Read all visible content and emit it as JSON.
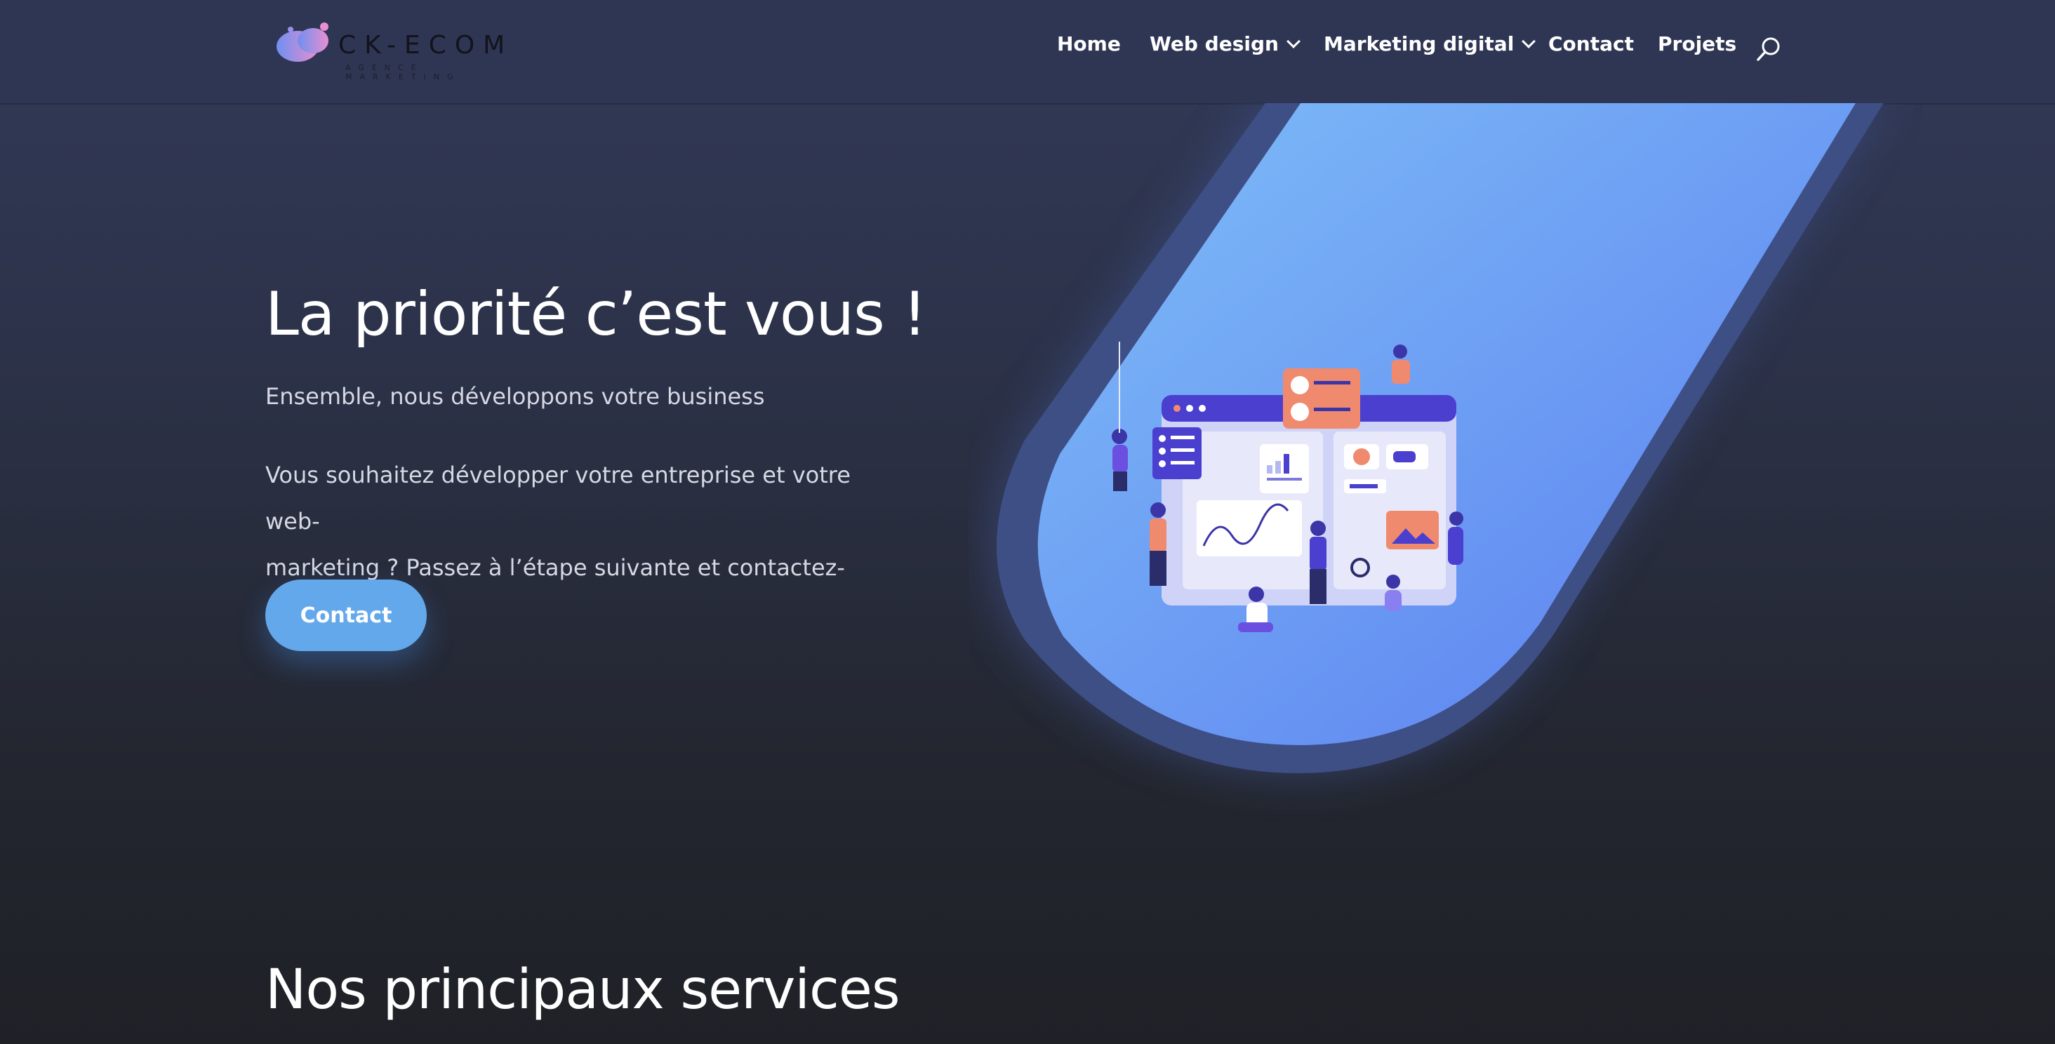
{
  "brand": {
    "name": "CK-ECOM",
    "tagline": "AGENCE MARKETING"
  },
  "nav": {
    "items": [
      {
        "label": "Home",
        "dropdown": false
      },
      {
        "label": "Web design",
        "dropdown": true
      },
      {
        "label": "Marketing digital",
        "dropdown": true
      },
      {
        "label": "Contact",
        "dropdown": false
      },
      {
        "label": "Projets",
        "dropdown": false
      }
    ],
    "search_icon": "search-icon"
  },
  "hero": {
    "title": "La priorité c’est vous !",
    "subtitle": "Ensemble, nous développons votre business",
    "body_line1": "Vous souhaitez développer votre entreprise et votre web-",
    "body_line2": "marketing ? Passez à l’étape suivante et contactez-nous !",
    "cta_label": "Contact",
    "illustration": "team-dashboard-illustration"
  },
  "services": {
    "title": "Nos principaux services"
  },
  "colors": {
    "header_bg": "#2f3654",
    "accent": "#64a8ec",
    "panel_gradient_start": "#7fbef7",
    "panel_gradient_end": "#5a7cf0"
  }
}
